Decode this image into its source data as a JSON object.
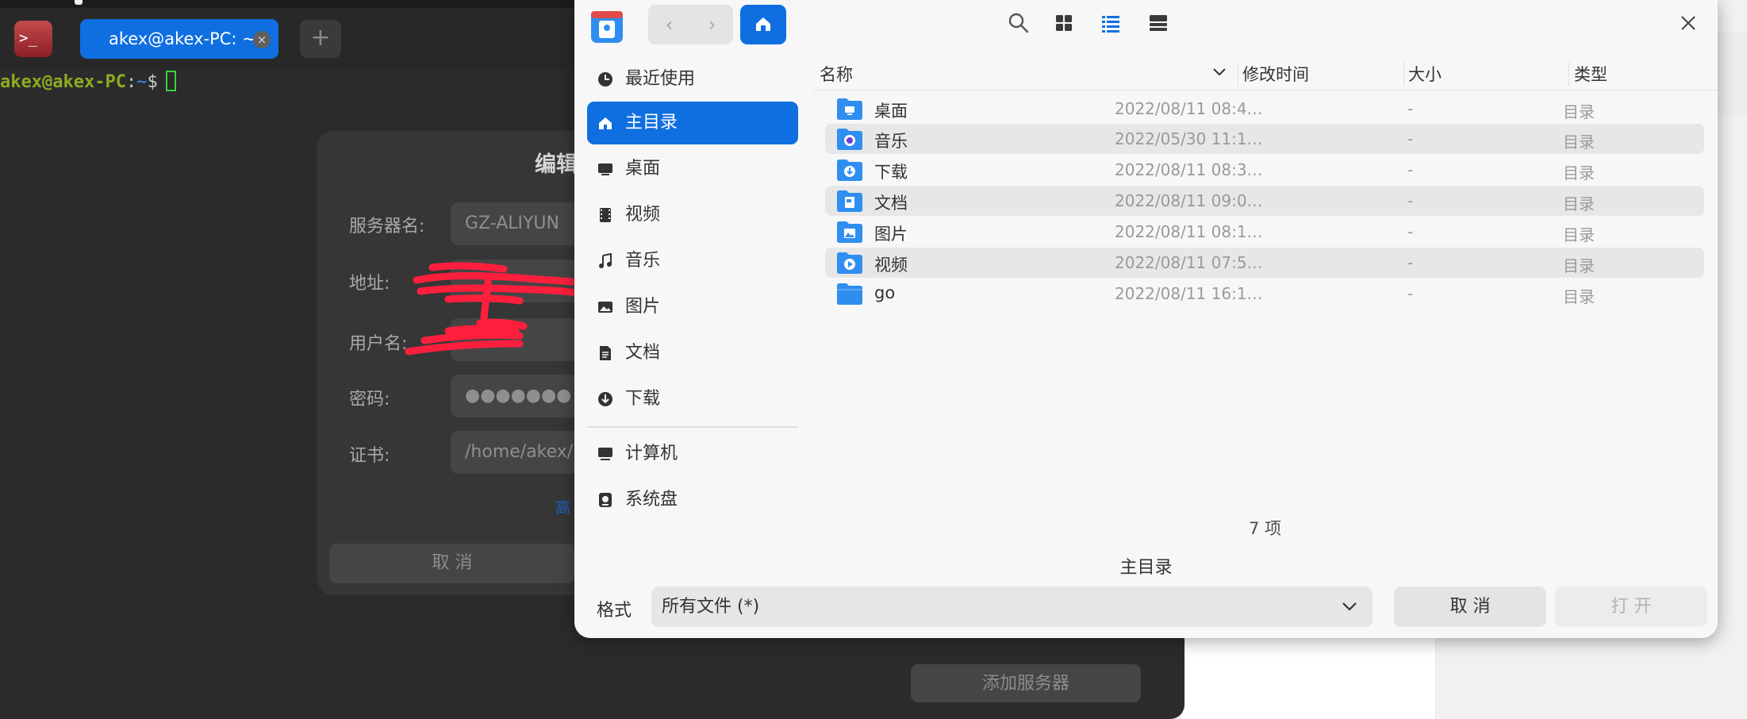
{
  "terminal": {
    "tab_label": "akex@akex-PC: ~",
    "tab_close": "×",
    "new_tab": "+",
    "app_icon_text": ">_",
    "prompt_user": "akex@akex-PC",
    "prompt_colon": ":",
    "prompt_path": "~",
    "prompt_dollar": "$",
    "add_server_button": "添加服务器"
  },
  "edit_dialog": {
    "title": "编辑",
    "fields": [
      {
        "label": "服务器名:",
        "value": "GZ-ALIYUN"
      },
      {
        "label": "地址:",
        "value": ""
      },
      {
        "label": "用户名:",
        "value": ""
      },
      {
        "label": "密码:",
        "value": "●●●●●●●"
      },
      {
        "label": "证书:",
        "value": "/home/akex/"
      }
    ],
    "advanced_link": "高",
    "cancel_button": "取 消"
  },
  "file_dialog": {
    "sidebar": [
      {
        "label": "最近使用",
        "icon": "clock-icon"
      },
      {
        "label": "主目录",
        "icon": "home-icon",
        "active": true
      },
      {
        "label": "桌面",
        "icon": "desktop-icon"
      },
      {
        "label": "视频",
        "icon": "film-icon"
      },
      {
        "label": "音乐",
        "icon": "music-note-icon"
      },
      {
        "label": "图片",
        "icon": "image-icon"
      },
      {
        "label": "文档",
        "icon": "document-icon"
      },
      {
        "label": "下载",
        "icon": "download-icon"
      },
      {
        "label": "计算机",
        "icon": "computer-icon"
      },
      {
        "label": "系统盘",
        "icon": "disk-icon"
      }
    ],
    "columns": {
      "name": "名称",
      "modified": "修改时间",
      "size": "大小",
      "type": "类型"
    },
    "files": [
      {
        "name": "桌面",
        "modified": "2022/08/11 08:4…",
        "size": "-",
        "type": "目录",
        "icon": "desktop-folder-icon"
      },
      {
        "name": "音乐",
        "modified": "2022/05/30 11:1…",
        "size": "-",
        "type": "目录",
        "icon": "music-folder-icon"
      },
      {
        "name": "下载",
        "modified": "2022/08/11 08:3…",
        "size": "-",
        "type": "目录",
        "icon": "download-folder-icon"
      },
      {
        "name": "文档",
        "modified": "2022/08/11 09:0…",
        "size": "-",
        "type": "目录",
        "icon": "documents-folder-icon"
      },
      {
        "name": "图片",
        "modified": "2022/08/11 08:1…",
        "size": "-",
        "type": "目录",
        "icon": "pictures-folder-icon"
      },
      {
        "name": "视频",
        "modified": "2022/08/11 07:5…",
        "size": "-",
        "type": "目录",
        "icon": "videos-folder-icon"
      },
      {
        "name": "go",
        "modified": "2022/08/11 16:1…",
        "size": "-",
        "type": "目录",
        "icon": "folder-icon"
      }
    ],
    "item_count": "7 项",
    "current_path": "主目录",
    "format_label": "格式",
    "format_value": "所有文件 (*)",
    "cancel_button": "取 消",
    "open_button": "打 开",
    "nav_back": "‹",
    "nav_forward": "›"
  },
  "colors": {
    "accent": "#0f6fe0",
    "terminal_bg": "#2b2b2b",
    "prompt_user": "#8dac20",
    "cursor": "#38d43b",
    "scribble": "#ff1f3d"
  }
}
